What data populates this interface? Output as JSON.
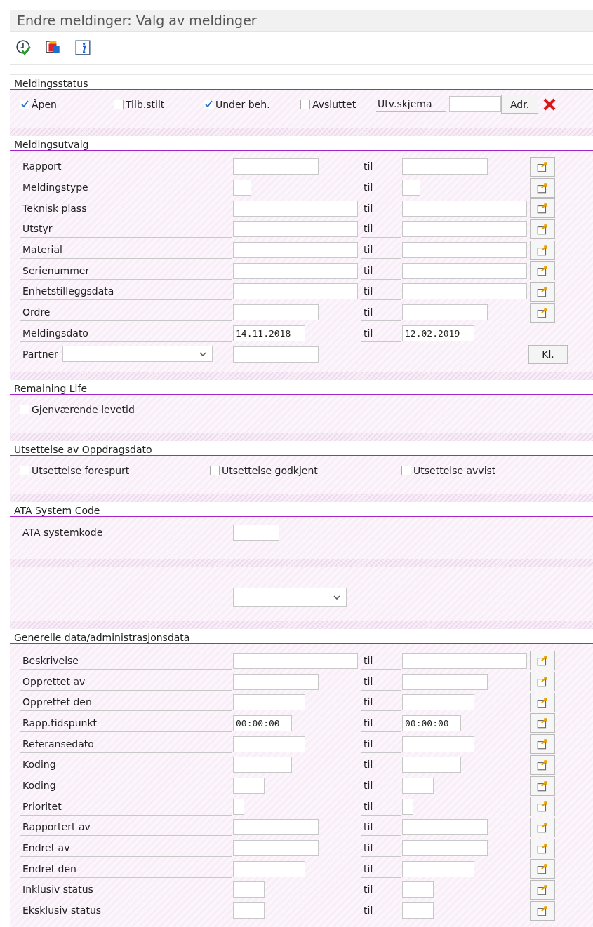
{
  "window": {
    "title": "Endre meldinger: Valg av meldinger"
  },
  "status_section": {
    "title": "Meldingsstatus",
    "checkboxes": [
      {
        "label": "Åpen",
        "checked": true
      },
      {
        "label": "Tilb.stilt",
        "checked": false
      },
      {
        "label": "Under beh.",
        "checked": true
      },
      {
        "label": "Avsluttet",
        "checked": false
      }
    ],
    "layout_label": "Utv.skjema",
    "address_button": "Adr."
  },
  "selection_section": {
    "title": "Meldingsutvalg",
    "rows": [
      {
        "kind": "range",
        "label": "Rapport",
        "to_label": "til",
        "multi": true
      },
      {
        "kind": "range",
        "label": "Meldingstype",
        "to_label": "til",
        "multi": true
      },
      {
        "kind": "range",
        "label": "Teknisk plass",
        "to_label": "til",
        "multi": true
      },
      {
        "kind": "range",
        "label": "Utstyr",
        "to_label": "til",
        "multi": true
      },
      {
        "kind": "range",
        "label": "Material",
        "to_label": "til",
        "multi": true
      },
      {
        "kind": "range",
        "label": "Serienummer",
        "to_label": "til",
        "multi": true
      },
      {
        "kind": "range",
        "label": "Enhetstilleggsdata",
        "to_label": "til",
        "multi": true
      },
      {
        "kind": "range",
        "label": "Ordre",
        "to_label": "til",
        "multi": true
      },
      {
        "kind": "range",
        "label": "Meldingsdato",
        "from": "14.11.2018",
        "to_label": "til",
        "to": "12.02.2019",
        "multi": false
      },
      {
        "kind": "partner",
        "label": "Partner",
        "button": "Kl."
      }
    ]
  },
  "remaining_life_section": {
    "title": "Remaining Life",
    "checkboxes": [
      {
        "label": "Gjenværende levetid",
        "checked": false
      }
    ]
  },
  "postponement_section": {
    "title": "Utsettelse av Oppdragsdato",
    "checkboxes": [
      {
        "label": "Utsettelse forespurt",
        "checked": false
      },
      {
        "label": "Utsettelse godkjent",
        "checked": false
      },
      {
        "label": "Utsettelse avvist",
        "checked": false
      }
    ]
  },
  "ata_section": {
    "title": "ATA System Code",
    "rows": [
      {
        "kind": "single",
        "label": "ATA systemkode"
      }
    ]
  },
  "general_section": {
    "title": "Generelle data/administrasjonsdata",
    "rows": [
      {
        "kind": "range",
        "label": "Beskrivelse",
        "to_label": "til",
        "multi": true
      },
      {
        "kind": "range",
        "label": "Opprettet av",
        "to_label": "til",
        "multi": true
      },
      {
        "kind": "range",
        "label": "Opprettet den",
        "to_label": "til",
        "multi": true
      },
      {
        "kind": "range",
        "label": "Rapp.tidspunkt",
        "from": "00:00:00",
        "to_label": "til",
        "to": "00:00:00",
        "multi": true
      },
      {
        "kind": "range",
        "label": "Referansedato",
        "to_label": "til",
        "multi": true
      },
      {
        "kind": "range",
        "label": "Koding",
        "to_label": "til",
        "multi": true
      },
      {
        "kind": "range",
        "label": "Koding",
        "to_label": "til",
        "multi": true
      },
      {
        "kind": "range",
        "label": "Prioritet",
        "to_label": "til",
        "multi": true
      },
      {
        "kind": "range",
        "label": "Rapportert av",
        "to_label": "til",
        "multi": true
      },
      {
        "kind": "range",
        "label": "Endret av",
        "to_label": "til",
        "multi": true
      },
      {
        "kind": "range",
        "label": "Endret den",
        "to_label": "til",
        "multi": true
      },
      {
        "kind": "range",
        "label": "Inklusiv status",
        "to_label": "til",
        "multi": true
      },
      {
        "kind": "range",
        "label": "Eksklusiv status",
        "to_label": "til",
        "multi": true
      }
    ]
  }
}
